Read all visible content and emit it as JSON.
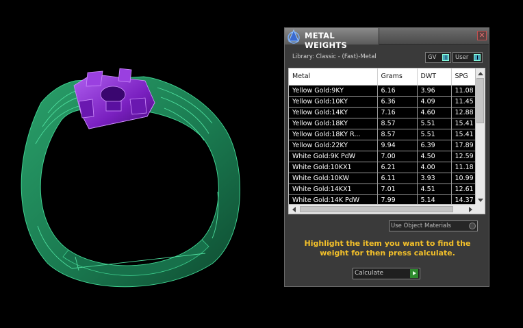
{
  "panel": {
    "title": "METAL WEIGHTS",
    "close_glyph": "✕",
    "library_label": "Library: Classic - (Fast)-Metal",
    "gv_label": "GV",
    "user_label": "User",
    "columns": [
      "Metal",
      "Grams",
      "DWT",
      "SPG"
    ],
    "rows": [
      [
        "Yellow Gold:9KY",
        "6.16",
        "3.96",
        "11.08"
      ],
      [
        "Yellow Gold:10KY",
        "6.36",
        "4.09",
        "11.45"
      ],
      [
        "Yellow Gold:14KY",
        "7.16",
        "4.60",
        "12.88"
      ],
      [
        "Yellow Gold:18KY",
        "8.57",
        "5.51",
        "15.41"
      ],
      [
        "Yellow Gold:18KY R...",
        "8.57",
        "5.51",
        "15.41"
      ],
      [
        "Yellow Gold:22KY",
        "9.94",
        "6.39",
        "17.89"
      ],
      [
        "White Gold:9K PdW",
        "7.00",
        "4.50",
        "12.59"
      ],
      [
        "White Gold:10KX1",
        "6.21",
        "4.00",
        "11.18"
      ],
      [
        "White Gold:10KW",
        "6.11",
        "3.93",
        "10.99"
      ],
      [
        "White Gold:14KX1",
        "7.01",
        "4.51",
        "12.61"
      ],
      [
        "White Gold:14K PdW",
        "7.99",
        "5.14",
        "14.37"
      ]
    ],
    "use_object_materials": "Use Object Materials",
    "instructions": "Highlight the item you want to find the weight for then press calculate.",
    "calculate_label": "Calculate"
  },
  "viewport": {
    "ring_color": "#1f8a5a",
    "stone_setting_color": "#8a2bd0"
  }
}
